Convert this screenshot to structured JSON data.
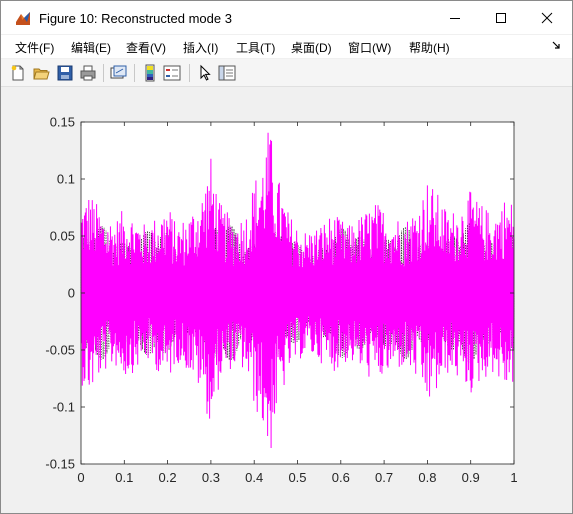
{
  "window": {
    "title": "Figure 10: Reconstructed mode 3",
    "icons": [
      "matlab-figure-icon",
      "minimize-icon",
      "maximize-icon",
      "close-icon"
    ]
  },
  "menu": {
    "items": [
      "文件(F)",
      "编辑(E)",
      "查看(V)",
      "插入(I)",
      "工具(T)",
      "桌面(D)",
      "窗口(W)",
      "帮助(H)"
    ],
    "overflow_icon": "dock-arrow-icon"
  },
  "toolbar": {
    "buttons": [
      "new-figure-icon",
      "open-file-icon",
      "save-icon",
      "print-icon",
      "link-plot-icon",
      "insert-colorbar-icon",
      "insert-legend-icon",
      "edit-plot-arrow-icon",
      "show-plot-tools-icon"
    ]
  },
  "chart_data": {
    "type": "line",
    "title": "",
    "xlabel": "",
    "ylabel": "",
    "xlim": [
      0,
      1
    ],
    "ylim": [
      -0.15,
      0.15
    ],
    "x_ticks": [
      0,
      0.1,
      0.2,
      0.3,
      0.4,
      0.5,
      0.6,
      0.7,
      0.8,
      0.9,
      1
    ],
    "x_tick_labels": [
      "0",
      "0.1",
      "0.2",
      "0.3",
      "0.4",
      "0.5",
      "0.6",
      "0.7",
      "0.8",
      "0.9",
      "1"
    ],
    "y_ticks": [
      -0.15,
      -0.1,
      -0.05,
      0,
      0.05,
      0.1,
      0.15
    ],
    "y_tick_labels": [
      "-0.15",
      "-0.1",
      "-0.05",
      "0",
      "0.05",
      "0.1",
      "0.15"
    ],
    "grid": false,
    "series": [
      {
        "style": "dotted",
        "color": "#000000",
        "description_amplitude_envelope": {
          "x": [
            0,
            0.05,
            0.1,
            0.15,
            0.2,
            0.25,
            0.3,
            0.35,
            0.4,
            0.45,
            0.5,
            0.55,
            0.6,
            0.65,
            0.7,
            0.75,
            0.8,
            0.85,
            0.9,
            0.95,
            1
          ],
          "amplitude": [
            0.055,
            0.06,
            0.062,
            0.06,
            0.055,
            0.05,
            0.06,
            0.065,
            0.06,
            0.055,
            0.05,
            0.052,
            0.057,
            0.06,
            0.06,
            0.058,
            0.055,
            0.06,
            0.062,
            0.06,
            0.06
          ]
        }
      },
      {
        "style": "solid",
        "color": "#ff00ff",
        "amplitude_envelope": {
          "x": [
            0,
            0.02,
            0.05,
            0.08,
            0.1,
            0.12,
            0.15,
            0.18,
            0.2,
            0.22,
            0.25,
            0.28,
            0.3,
            0.32,
            0.35,
            0.38,
            0.4,
            0.42,
            0.435,
            0.45,
            0.48,
            0.5,
            0.52,
            0.55,
            0.58,
            0.6,
            0.62,
            0.65,
            0.68,
            0.7,
            0.72,
            0.75,
            0.78,
            0.8,
            0.82,
            0.85,
            0.88,
            0.9,
            0.92,
            0.95,
            0.98,
            1
          ],
          "amplitude": [
            0.08,
            0.09,
            0.07,
            0.065,
            0.075,
            0.07,
            0.06,
            0.07,
            0.08,
            0.06,
            0.07,
            0.09,
            0.12,
            0.08,
            0.065,
            0.07,
            0.1,
            0.12,
            0.15,
            0.11,
            0.07,
            0.06,
            0.055,
            0.06,
            0.07,
            0.065,
            0.06,
            0.07,
            0.08,
            0.075,
            0.07,
            0.065,
            0.08,
            0.1,
            0.09,
            0.07,
            0.08,
            0.09,
            0.08,
            0.07,
            0.085,
            0.08
          ]
        }
      }
    ]
  }
}
